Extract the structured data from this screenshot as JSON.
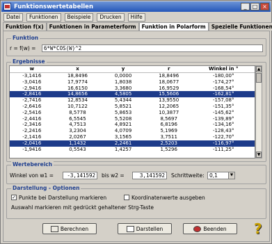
{
  "window": {
    "title": "Funktionswertetabellen"
  },
  "menu": [
    "Datei",
    "Funktionen",
    "Beispiele",
    "Drucken",
    "Hilfe"
  ],
  "tabs": [
    "Funktion f(x)",
    "Funktionen in Parameterform",
    "Funktion in Polarform",
    "Spezielle Funktionen"
  ],
  "funktion": {
    "group": "Funktion",
    "label": "r = f(w) =",
    "value": "6*W*COS(W)^2"
  },
  "ergebnisse": {
    "group": "Ergebnisse",
    "columns": [
      "w",
      "x",
      "y",
      "r",
      "Winkel in °"
    ],
    "rows": [
      [
        "-3,1416",
        "18,8496",
        "0,0000",
        "18,8496",
        "-180,00°"
      ],
      [
        "-3,0416",
        "17,9774",
        "1,8038",
        "18,0677",
        "-174,27°"
      ],
      [
        "-2,9416",
        "16,6150",
        "3,3680",
        "16,9529",
        "-168,54°"
      ],
      [
        "-2,8416",
        "14,8656",
        "4,5805",
        "15,5606",
        "-162,81°"
      ],
      [
        "-2,7416",
        "12,8534",
        "5,4344",
        "13,9550",
        "-157,08°"
      ],
      [
        "-2,6416",
        "10,7122",
        "5,8521",
        "12,2065",
        "-151,35°"
      ],
      [
        "-2,5416",
        "8,5778",
        "5,8653",
        "10,3877",
        "-145,62°"
      ],
      [
        "-2,4416",
        "6,5545",
        "5,5208",
        "8,5697",
        "-139,89°"
      ],
      [
        "-2,3416",
        "4,7513",
        "4,8921",
        "6,8196",
        "-134,16°"
      ],
      [
        "-2,2416",
        "3,2304",
        "4,0709",
        "5,1969",
        "-128,43°"
      ],
      [
        "-2,1416",
        "2,0267",
        "3,1565",
        "3,7511",
        "-122,70°"
      ],
      [
        "-2,0416",
        "1,1432",
        "2,2461",
        "2,5203",
        "-116,97°"
      ],
      [
        "-1,9416",
        "0,5543",
        "1,4257",
        "1,5296",
        "-111,25°"
      ]
    ],
    "selected_rows": [
      3,
      11
    ]
  },
  "wertebereich": {
    "group": "Wertebereich",
    "von_label": "Winkel von w1 =",
    "von": "-3,141592",
    "bis_label": "bis w2 =",
    "bis": "3,141592",
    "schritt_label": "Schrittweite:",
    "schritt": "0,1"
  },
  "darstellung": {
    "group": "Darstellung - Optionen",
    "opt1": "Punkte bei Darstellung markieren",
    "opt1_checked": "✓",
    "opt2": "Koordinatenwerte ausgeben",
    "hint": "Auswahl markieren mit gedrückt gehaltener Strg-Taste"
  },
  "buttons": {
    "berechnen": "Berechnen",
    "darstellen": "Darstellen",
    "beenden": "Beenden"
  },
  "help": "?"
}
